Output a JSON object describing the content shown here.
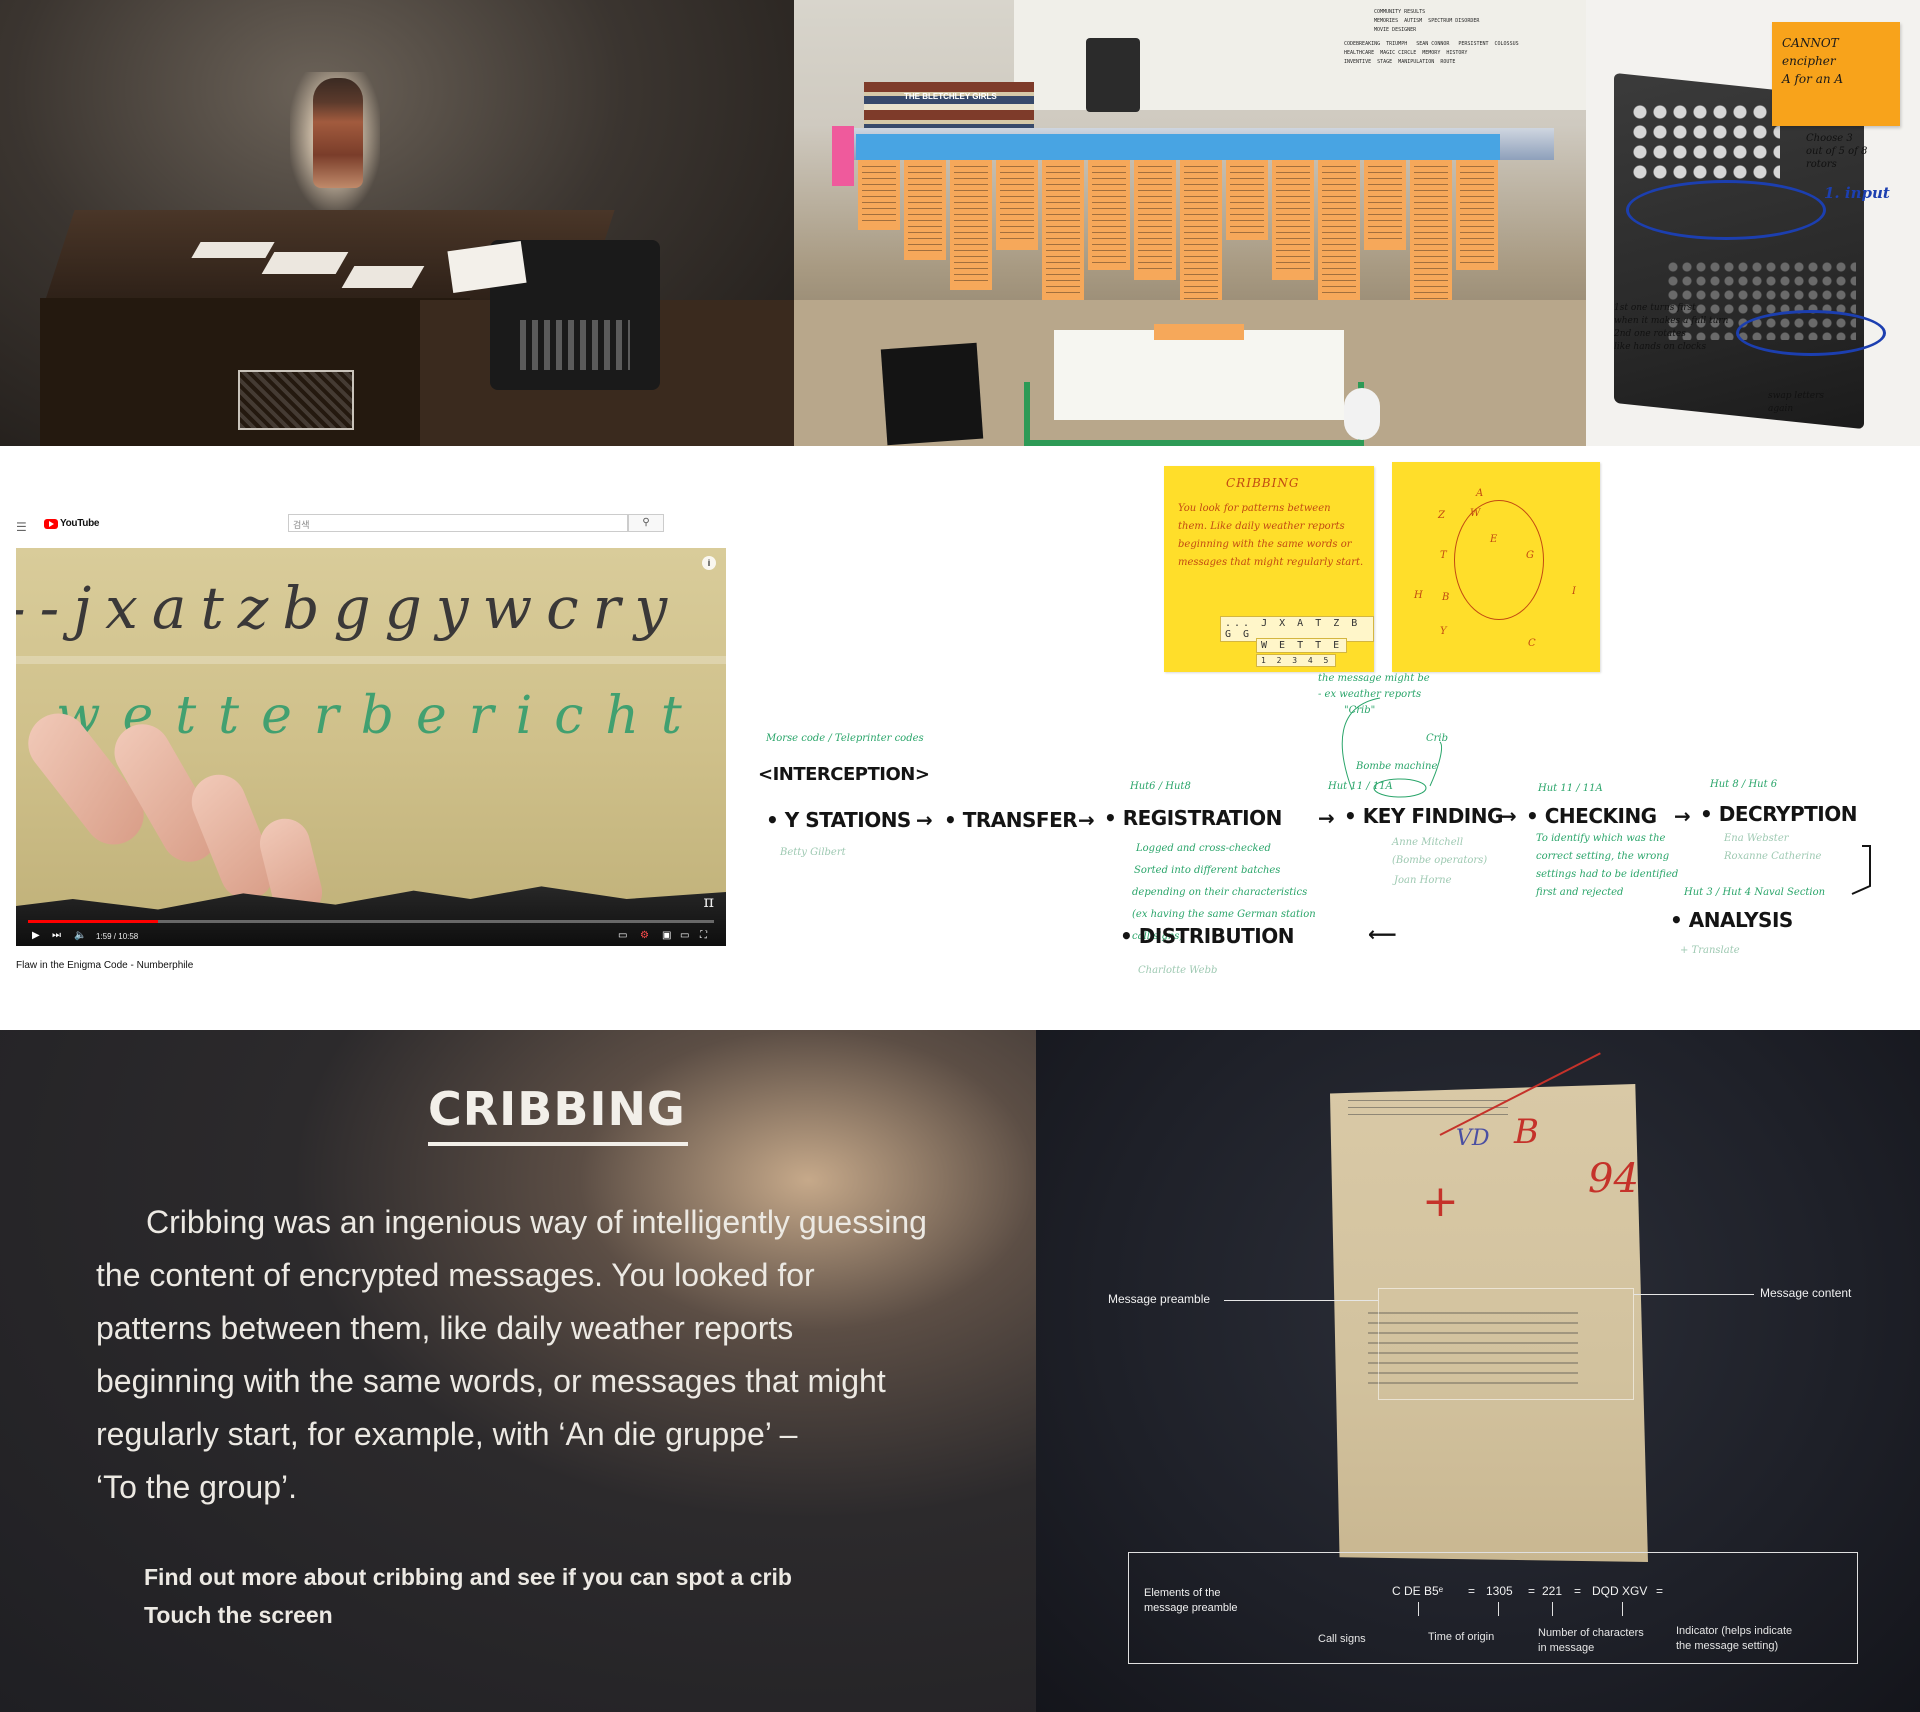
{
  "enigma": {
    "note_line1": "CANNOT encipher",
    "note_line2": "A for an A",
    "choose": "Choose 3\nout of 5 of 8\nrotors",
    "input": "1. input",
    "rotors_note": "1st one turns first\nwhen it makes a full turn\n2nd one rotates\nlike hands on clocks",
    "swap": "swap letters\nagain"
  },
  "youtube": {
    "brand": "YouTube",
    "search_placeholder": "검색",
    "video_line1": "--jxatzbggywcry",
    "video_line2": "wetterbericht",
    "time": "1:59 / 10:58",
    "progress": 0.19,
    "title": "Flaw in the Enigma Code - Numberphile"
  },
  "flow": {
    "crib_note": {
      "title": "CRIBBING",
      "lines": [
        "You look for patterns between",
        "them. Like daily weather reports",
        "beginning with the same words or",
        "messages that might regularly start."
      ],
      "strip1": "... J X A T Z B G G",
      "strip2": "W E T T E",
      "strip3": "1 2 3 4 5"
    },
    "crib_annot": [
      "the message might be",
      "- ex weather reports",
      "\"Crib\""
    ],
    "crib_label": "Crib",
    "bombe_label": "Bombe machine",
    "morse": "Morse code / Teleprinter codes",
    "interception": "<INTERCEPTION>",
    "stages": [
      "• Y STATIONS",
      "• TRANSFER",
      "• REGISTRATION",
      "• KEY FINDING",
      "• CHECKING",
      "• DECRYPTION"
    ],
    "arrows": [
      "→",
      "→",
      "→",
      "→",
      "→"
    ],
    "betty": "Betty Gilbert",
    "hut6": "Hut6 / Hut8",
    "hut11": "Hut 11 / 11A",
    "hut11b": "Hut 11 / 11A",
    "hut8": "Hut 8 / Hut 6",
    "registration_notes": [
      "Logged and cross-checked",
      "Sorted into different batches",
      "depending on their characteristics",
      "(ex having the same German station",
      "call signs)"
    ],
    "anne": "Anne Mitchell",
    "bombe_operators": "(Bombe operators)",
    "joan": "Joan Horne",
    "checking_notes": [
      "To identify which was the",
      "correct setting, the wrong",
      "settings had to be identified",
      "first and rejected"
    ],
    "decryption_names": "Ena Webster",
    "decryption_names2": "Roxanne Catherine",
    "hut3": "Hut 3 / Hut 4 Naval Section",
    "analysis": "• ANALYSIS",
    "translate": "+ Translate",
    "distribution": "• DISTRIBUTION",
    "charlotte": "Charlotte Webb"
  },
  "board": {
    "title": "CRIBBING",
    "body_lines": [
      "Cribbing was an ingenious way of intelligently guessing",
      "the content of encrypted messages. You looked for",
      "patterns between them, like daily weather reports",
      "beginning with the same words, or messages that might",
      "regularly start, for example, with ‘An die gruppe’ –",
      "‘To the group’."
    ],
    "cta1": "Find out more about cribbing and see if you can spot a crib",
    "cta2": "Touch the screen"
  },
  "doc": {
    "preamble_label": "Message preamble",
    "content_label": "Message content",
    "red_94": "94",
    "red_b": "B",
    "legend_title": "Elements of the\nmessage preamble",
    "callsigns": "C DE B5ᵉ",
    "time": "1305",
    "chars": "221",
    "indicator": "DQD XGV",
    "eq": "=",
    "labels": {
      "callsigns": "Call signs",
      "time": "Time of origin",
      "chars": "Number of characters\nin message",
      "indicator": "Indicator (helps indicate\nthe message setting)"
    }
  },
  "colors": {
    "sticky_orange": "#f6a85a",
    "sticky_blue": "#48a4e3",
    "note_yellow": "#ffde2a",
    "green_ink": "#2aa56a",
    "red_ink": "#c5322a",
    "yt_red": "#ff0000"
  }
}
